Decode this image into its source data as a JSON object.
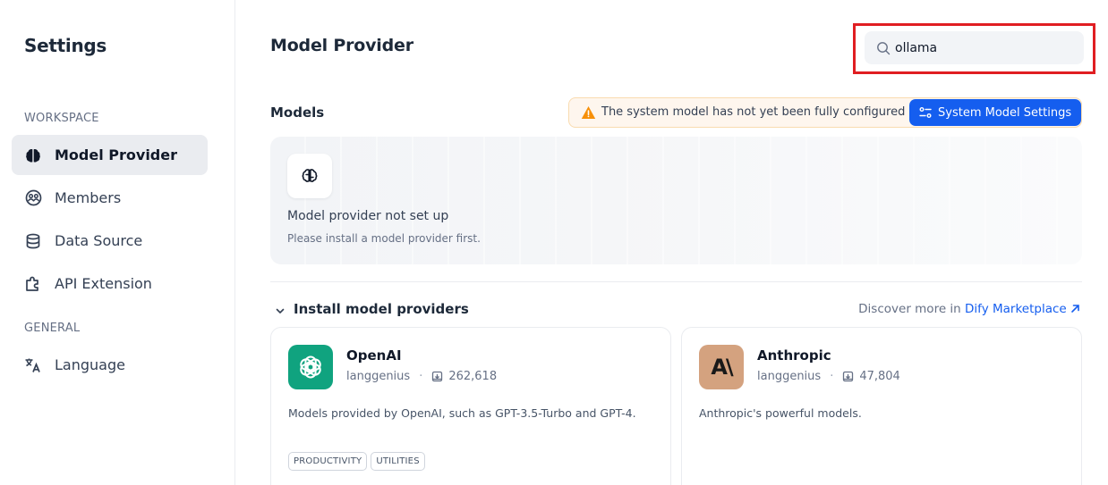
{
  "sidebar": {
    "title": "Settings",
    "groups": [
      {
        "label": "WORKSPACE"
      },
      {
        "label": "GENERAL"
      }
    ],
    "items": [
      {
        "label": "Model Provider",
        "icon": "brain-icon"
      },
      {
        "label": "Members",
        "icon": "members-icon"
      },
      {
        "label": "Data Source",
        "icon": "database-icon"
      },
      {
        "label": "API Extension",
        "icon": "puzzle-icon"
      },
      {
        "label": "Language",
        "icon": "translate-icon"
      }
    ]
  },
  "header": {
    "title": "Model Provider",
    "search": {
      "value": "ollama",
      "placeholder": "Search"
    }
  },
  "models": {
    "label": "Models",
    "warning": "The system model has not yet been fully configured",
    "system_button": "System Model Settings",
    "empty_title": "Model provider not set up",
    "empty_sub": "Please install a model provider first."
  },
  "install": {
    "title": "Install model providers",
    "discover_prefix": "Discover more in",
    "discover_link": "Dify Marketplace",
    "providers": [
      {
        "name": "OpenAI",
        "org": "langgenius",
        "downloads": "262,618",
        "description": "Models provided by OpenAI, such as GPT-3.5-Turbo and GPT-4.",
        "tags": [
          "PRODUCTIVITY",
          "UTILITIES"
        ],
        "logo_color": "#10a37f",
        "logo_text": ""
      },
      {
        "name": "Anthropic",
        "org": "langgenius",
        "downloads": "47,804",
        "description": "Anthropic's powerful models.",
        "tags": [],
        "logo_color": "#d4a27f",
        "logo_text": "A\\"
      }
    ]
  },
  "colors": {
    "accent": "#155eef",
    "highlight_border": "#e01e22",
    "warning": "#f79009"
  }
}
